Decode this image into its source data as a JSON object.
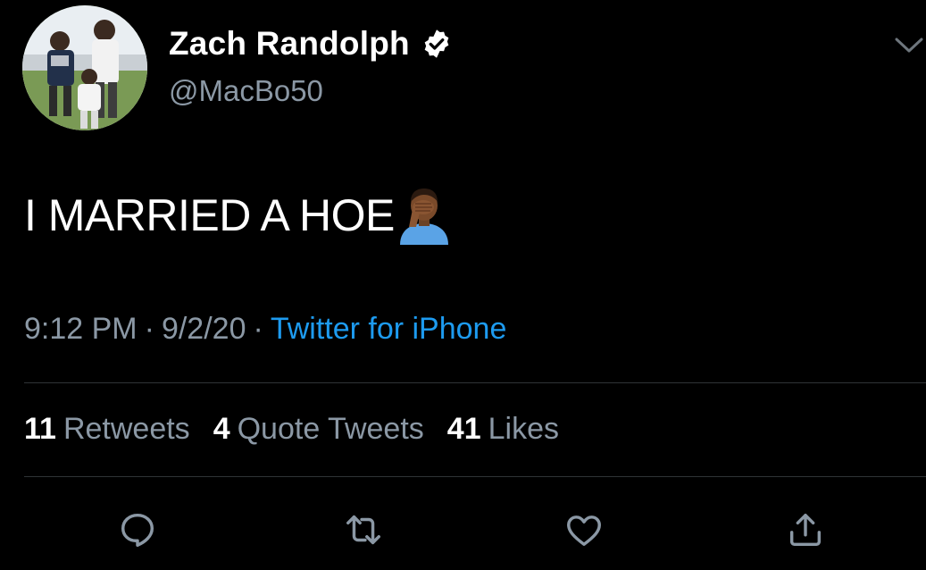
{
  "user": {
    "display_name": "Zach Randolph",
    "handle": "@MacBo50",
    "verified": true,
    "avatar": "avatar-photo"
  },
  "tweet": {
    "text": "I MARRIED A HOE",
    "emoji": "man-facepalming-emoji"
  },
  "meta": {
    "time": "9:12 PM",
    "separator": "·",
    "date": "9/2/20",
    "source": "Twitter for iPhone"
  },
  "stats": {
    "retweets_count": "11",
    "retweets_label": "Retweets",
    "quotes_count": "4",
    "quotes_label": "Quote Tweets",
    "likes_count": "41",
    "likes_label": "Likes"
  },
  "actions": [
    "reply-icon",
    "retweet-icon",
    "like-icon",
    "share-icon"
  ],
  "colors": {
    "background": "#000000",
    "text": "#ffffff",
    "muted": "#8b98a5",
    "link": "#1d9bf0",
    "divider": "#2f3336"
  }
}
